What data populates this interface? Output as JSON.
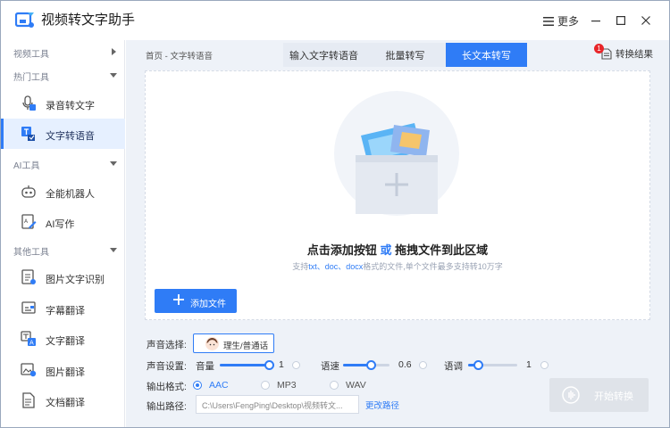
{
  "titlebar": {
    "app_title": "视频转文字助手",
    "more_label": "更多",
    "icons": [
      "menu-icon",
      "minimize-icon",
      "maximize-icon",
      "close-icon"
    ]
  },
  "sidebar": {
    "sections": [
      {
        "label": "视频工具"
      },
      {
        "label": "热门工具"
      },
      {
        "label": "AI工具"
      },
      {
        "label": "其他工具"
      }
    ],
    "items": [
      {
        "label": "录音转文字",
        "icon": "record-to-text-icon"
      },
      {
        "label": "文字转语音",
        "icon": "text-to-speech-icon",
        "active": true
      },
      {
        "label": "全能机器人",
        "icon": "robot-icon"
      },
      {
        "label": "AI写作",
        "icon": "ai-writing-icon"
      },
      {
        "label": "图片文字识别",
        "icon": "image-ocr-icon"
      },
      {
        "label": "字幕翻译",
        "icon": "subtitle-translate-icon"
      },
      {
        "label": "文字翻译",
        "icon": "text-translate-icon"
      },
      {
        "label": "图片翻译",
        "icon": "image-translate-icon"
      },
      {
        "label": "文档翻译",
        "icon": "document-translate-icon"
      }
    ]
  },
  "main": {
    "breadcrumb": "首页 - 文字转语音",
    "tabs": [
      {
        "label": "输入文字转语音"
      },
      {
        "label": "批量转写"
      },
      {
        "label": "长文本转写",
        "active": true
      }
    ],
    "convert_result": {
      "label": "转换结果",
      "badge": "1"
    },
    "dropzone": {
      "title_a": "点击添加按钮",
      "title_or": "或",
      "title_b": "拖拽文件到此区域",
      "sub_a": "支持",
      "sub_ext": "txt、doc、docx",
      "sub_b": "格式的文件,单个文件最多支持转10万字"
    },
    "add_file_label": "添加文件"
  },
  "settings": {
    "voice": {
      "label": "声音选择:",
      "value": "理生/普通话"
    },
    "sound": {
      "label": "声音设置:",
      "volume": {
        "label": "音量",
        "value": "1",
        "fraction": 1.0
      },
      "speed": {
        "label": "语速",
        "value": "0.6",
        "fraction": 0.6
      },
      "pitch": {
        "label": "语调",
        "value": "1",
        "fraction": 0.2
      }
    },
    "format": {
      "label": "输出格式:",
      "options": [
        "AAC",
        "MP3",
        "WAV"
      ],
      "selected": "AAC"
    },
    "path": {
      "label": "输出路径:",
      "value": "C:\\Users\\FengPing\\Desktop\\视频转文...",
      "change_label": "更改路径"
    },
    "start_label": "开始转换"
  },
  "colors": {
    "accent": "#2f7cf6",
    "badge": "#e8262a",
    "main_bg": "#eef2f8"
  }
}
